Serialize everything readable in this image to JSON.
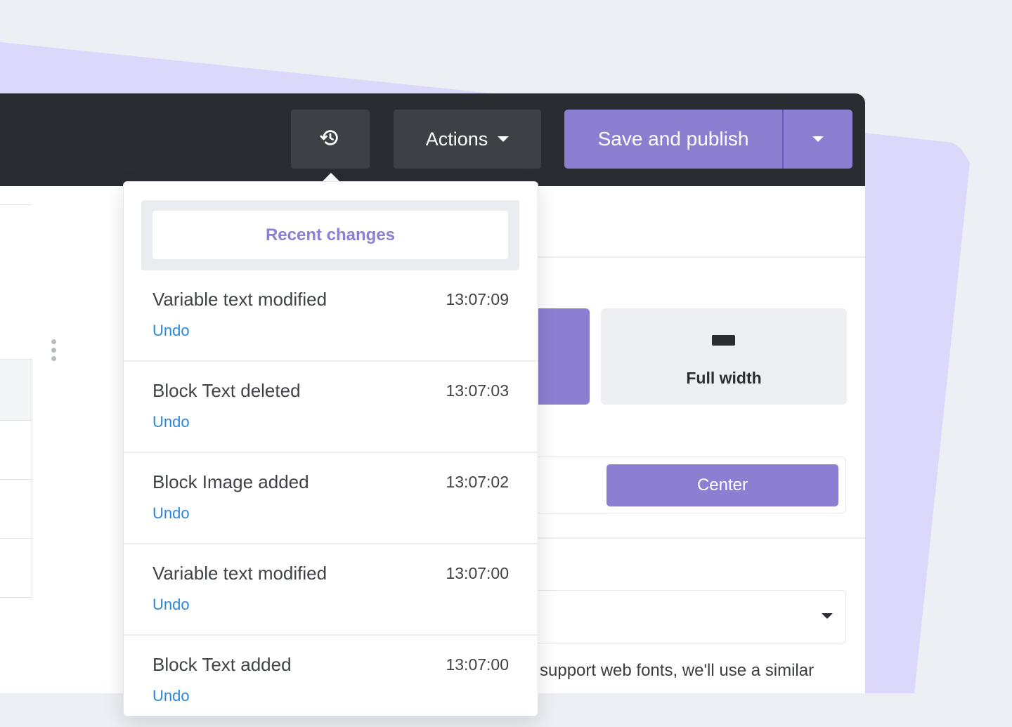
{
  "toolbar": {
    "history_icon": "history-icon",
    "actions_label": "Actions",
    "save_label": "Save and publish",
    "accent_color": "#8c7ed1"
  },
  "recent_changes": {
    "heading": "Recent changes",
    "items": [
      {
        "title": "Variable text modified",
        "time": "13:07:09",
        "action": "Undo"
      },
      {
        "title": "Block Text deleted",
        "time": "13:07:03",
        "action": "Undo"
      },
      {
        "title": "Block Image added",
        "time": "13:07:02",
        "action": "Undo"
      },
      {
        "title": "Variable text modified",
        "time": "13:07:00",
        "action": "Undo"
      },
      {
        "title": "Block Text added",
        "time": "13:07:00",
        "action": "Undo"
      }
    ]
  },
  "editor": {
    "width_option_label": "Full width",
    "alignment_label": "Center",
    "font_help_text": "support web fonts, we'll use a similar"
  }
}
